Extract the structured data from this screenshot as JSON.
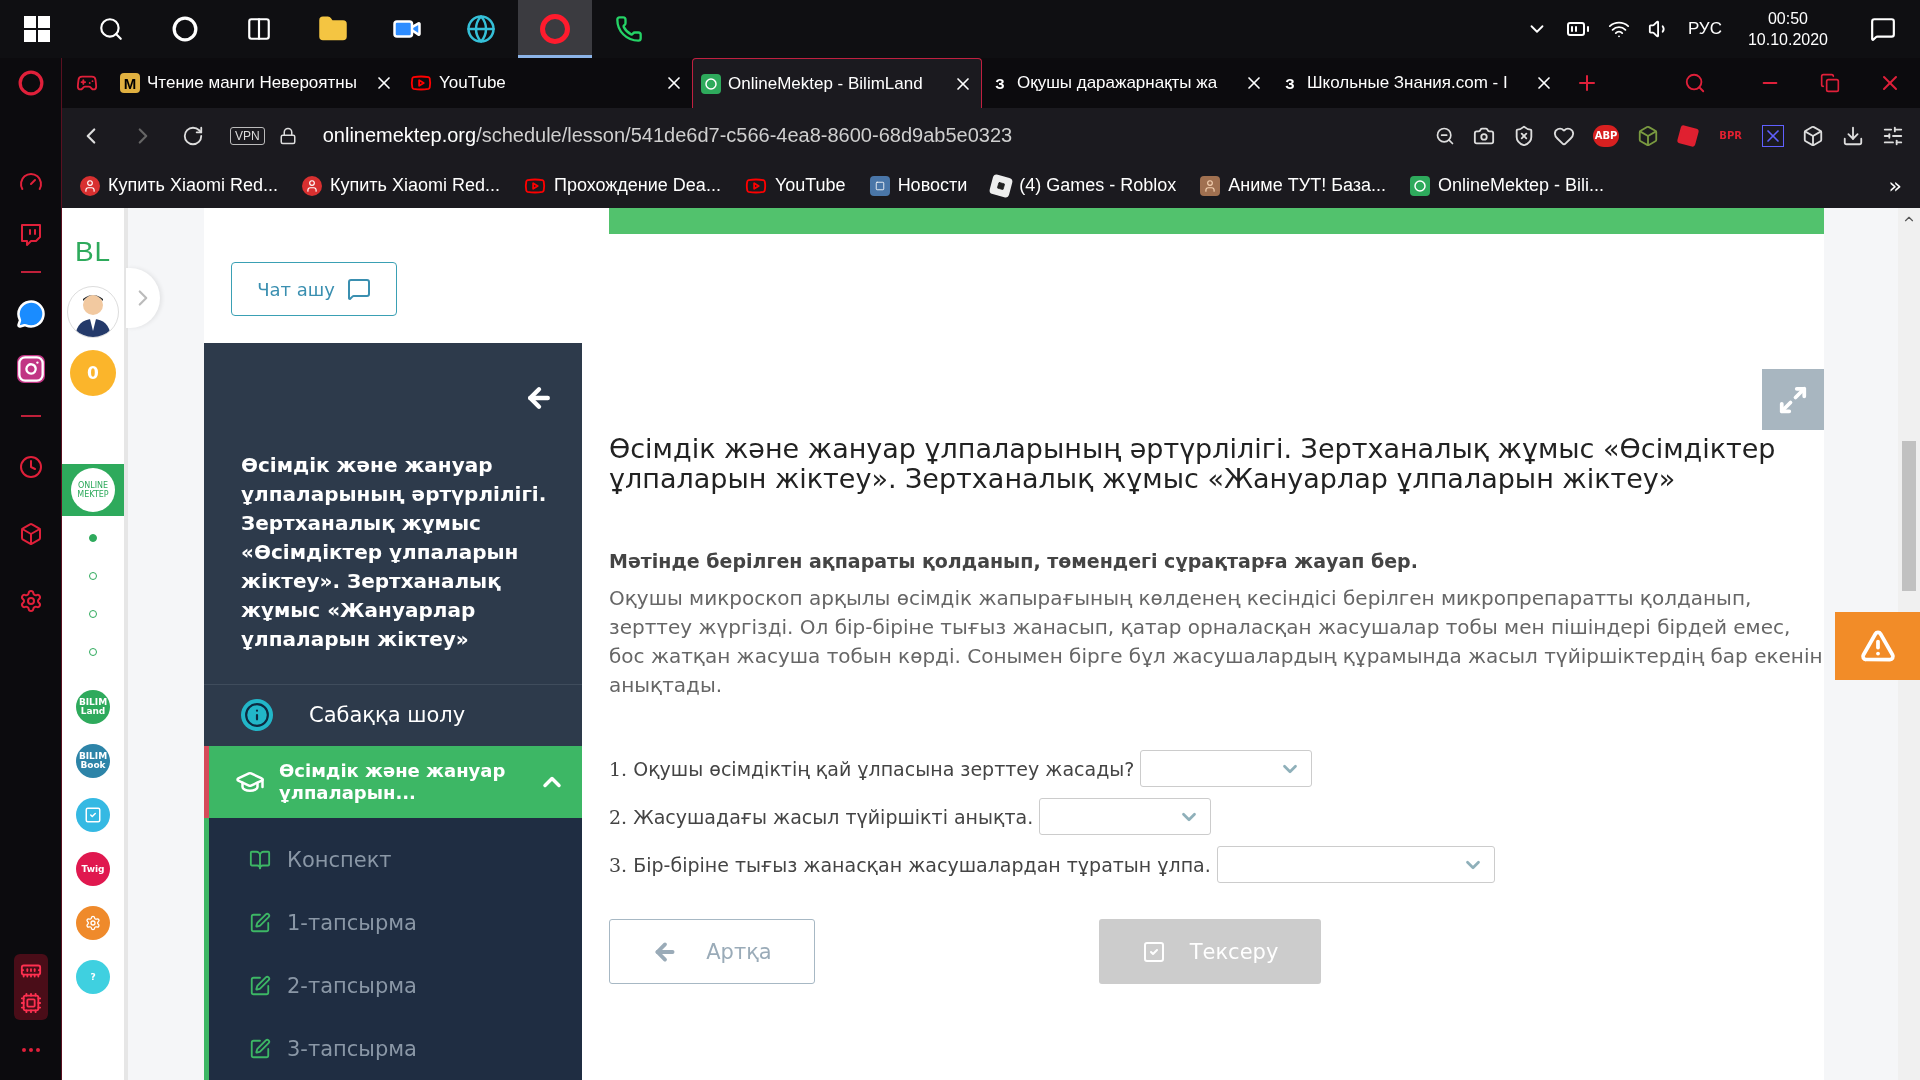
{
  "taskbar": {
    "apps": [
      {
        "kind": "search",
        "selected": false
      },
      {
        "kind": "cortana",
        "selected": false
      },
      {
        "kind": "taskview",
        "selected": false
      },
      {
        "kind": "explorer",
        "selected": false
      },
      {
        "kind": "zoom",
        "selected": false
      },
      {
        "kind": "edge",
        "selected": false
      },
      {
        "kind": "opera",
        "selected": true
      },
      {
        "kind": "whatsapp",
        "selected": false
      }
    ],
    "language": "РУС",
    "time": "00:50",
    "date": "10.10.2020"
  },
  "tabs": [
    {
      "kind": "manga",
      "badge": "M",
      "title": "Чтение манги Невероятны",
      "selected": false
    },
    {
      "kind": "youtube",
      "title": "YouTube",
      "selected": false
    },
    {
      "kind": "bilimland",
      "title": "OnlineMektep - BilimLand",
      "selected": true
    },
    {
      "kind": "znania",
      "badge": "З",
      "title": "Оқушы даражарнақты жа",
      "selected": false
    },
    {
      "kind": "znania",
      "badge": "З",
      "title": "Школьные Знания.com - I",
      "selected": false
    }
  ],
  "address_bar": {
    "vpn": "VPN",
    "host": "onlinemektep.org",
    "path": "/schedule/lesson/541de6d7-c566-4ea8-8600-68d9ab5e0323"
  },
  "extensions": [
    {
      "kind": "abp",
      "label": "ABP"
    },
    {
      "kind": "cube"
    },
    {
      "kind": "roblox"
    },
    {
      "kind": "bpr",
      "label": "BPR"
    },
    {
      "kind": "square"
    }
  ],
  "bookmarks": [
    {
      "kind": "xiaomi",
      "title": "Купить Xiaomi Red..."
    },
    {
      "kind": "xiaomi",
      "title": "Купить Xiaomi Red..."
    },
    {
      "kind": "youtube",
      "title": "Прохождение Dea..."
    },
    {
      "kind": "youtube",
      "title": "YouTube"
    },
    {
      "kind": "vk",
      "title": "Новости"
    },
    {
      "kind": "roblox",
      "title": "(4) Games - Roblox"
    },
    {
      "kind": "anime",
      "title": "Аниме ТУТ! База..."
    },
    {
      "kind": "bilimland",
      "title": "OnlineMektep - Bili..."
    }
  ],
  "bookmarks_more": "»",
  "rail": {
    "logo": "BL",
    "coins": "0",
    "home": "ONLINE MEKTEP",
    "steps": [
      {
        "selected": true
      },
      {
        "selected": false
      },
      {
        "selected": false
      },
      {
        "selected": false
      }
    ],
    "apps": [
      {
        "label": "BILIM Land",
        "color": "#2eaa5c"
      },
      {
        "label": "BILIM Book",
        "color": "#2d84a8"
      },
      {
        "kind": "test",
        "color": "#35b9e3"
      },
      {
        "label": "Twig",
        "color": "#e0184f"
      },
      {
        "kind": "mektep",
        "color": "#ef8a2b"
      },
      {
        "label": "?",
        "color": "#3fd0e0"
      }
    ]
  },
  "chat_button": "Чат ашу",
  "lesson_panel": {
    "title": "Өсімдік және жануар ұлпаларының әртүрлілігі. Зертханалық жұмыс «Өсімдіктер ұлпаларын жіктеу». Зертханалық жұмыс «Жануарлар ұлпаларын жіктеу»",
    "items": [
      {
        "kind": "overview",
        "label": "Сабаққа шолу",
        "selected": false
      },
      {
        "kind": "section",
        "label": "Өсімдік және жануар ұлпаларын...",
        "selected": true,
        "expanded": true,
        "children": [
          {
            "kind": "notes",
            "label": "Конспект"
          },
          {
            "kind": "task",
            "label": "1-тапсырма"
          },
          {
            "kind": "task",
            "label": "2-тапсырма"
          },
          {
            "kind": "task",
            "label": "3-тапсырма"
          }
        ]
      }
    ]
  },
  "lesson": {
    "title": "Өсімдік және жануар ұлпаларының әртүрлілігі. Зертханалық жұмыс «Өсімдіктер ұлпаларын жіктеу». Зертханалық жұмыс «Жануарлар ұлпаларын жіктеу»",
    "instruction": "Мәтінде берілген ақпараты қолданып, төмендегі сұрақтарға жауап бер.",
    "text": "Оқушы микроскоп арқылы өсімдік жапырағының көлденең кесіндісі берілген микропрепаратты қолданып, зерттеу жүргізді. Ол бір-біріне тығыз жанасып, қатар орналасқан жасушалар тобы мен пішіндері бірдей емес, бос жатқан жасуша тобын көрді. Сонымен бірге бұл жасушалардың құрамында жасыл түйіршіктердің бар екенін анықтады.",
    "questions": [
      {
        "number": "1.",
        "text": "Оқушы өсімдіктің қай ұлпасына зерттеу жасады?"
      },
      {
        "number": "2.",
        "text": "Жасушадағы жасыл түйіршікті анықта."
      },
      {
        "number": "3.",
        "text": "Бір-біріне тығыз жанасқан жасушалардан тұратын ұлпа."
      }
    ],
    "back_button": {
      "label": "Артқа",
      "disabled": false
    },
    "check_button": {
      "label": "Тексеру",
      "disabled": true
    }
  }
}
